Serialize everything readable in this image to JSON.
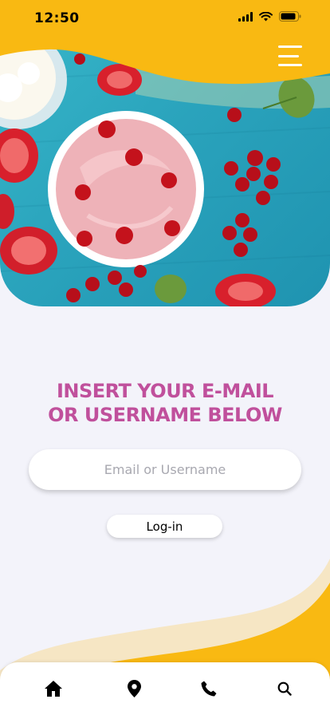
{
  "status_bar": {
    "time": "12:50",
    "icons": [
      "signal-icon",
      "wifi-icon",
      "battery-icon"
    ]
  },
  "header": {
    "menu_icon": "hamburger-menu-icon",
    "hero_image": "yogurt-with-berries-photo"
  },
  "login": {
    "heading_line1": "INSERT YOUR E-MAIL",
    "heading_line2": "OR USERNAME BELOW",
    "email_placeholder": "Email or Username",
    "email_value": "",
    "button_label": "Log-in"
  },
  "bottom_nav": {
    "items": [
      "home-icon",
      "location-pin-icon",
      "phone-icon",
      "search-icon"
    ]
  },
  "colors": {
    "accent_yellow": "#f9b912",
    "heading_pink": "#c0509c",
    "background": "#f3f3fa",
    "wave_cream": "#f6e6c4"
  }
}
